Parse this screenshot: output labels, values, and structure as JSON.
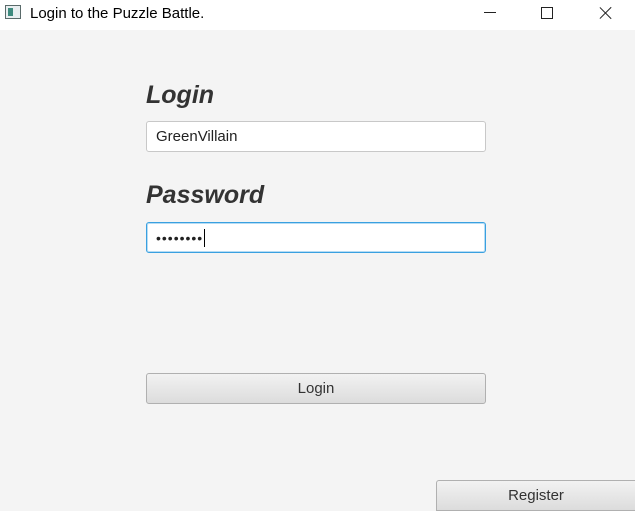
{
  "window": {
    "title": "Login to the Puzzle Battle.",
    "controls": {
      "minimize": "minimize",
      "maximize": "maximize",
      "close": "close"
    }
  },
  "form": {
    "login_label": "Login",
    "username_value": "GreenVillain",
    "password_label": "Password",
    "password_masked": "••••••••",
    "login_button": "Login",
    "register_button": "Register"
  },
  "colors": {
    "background": "#f4f4f4",
    "focus_border": "#39a0e0",
    "label_text": "#333333"
  },
  "icons": {
    "app": "app-window-icon",
    "minimize": "minimize-icon",
    "maximize": "maximize-icon",
    "close": "close-icon"
  }
}
